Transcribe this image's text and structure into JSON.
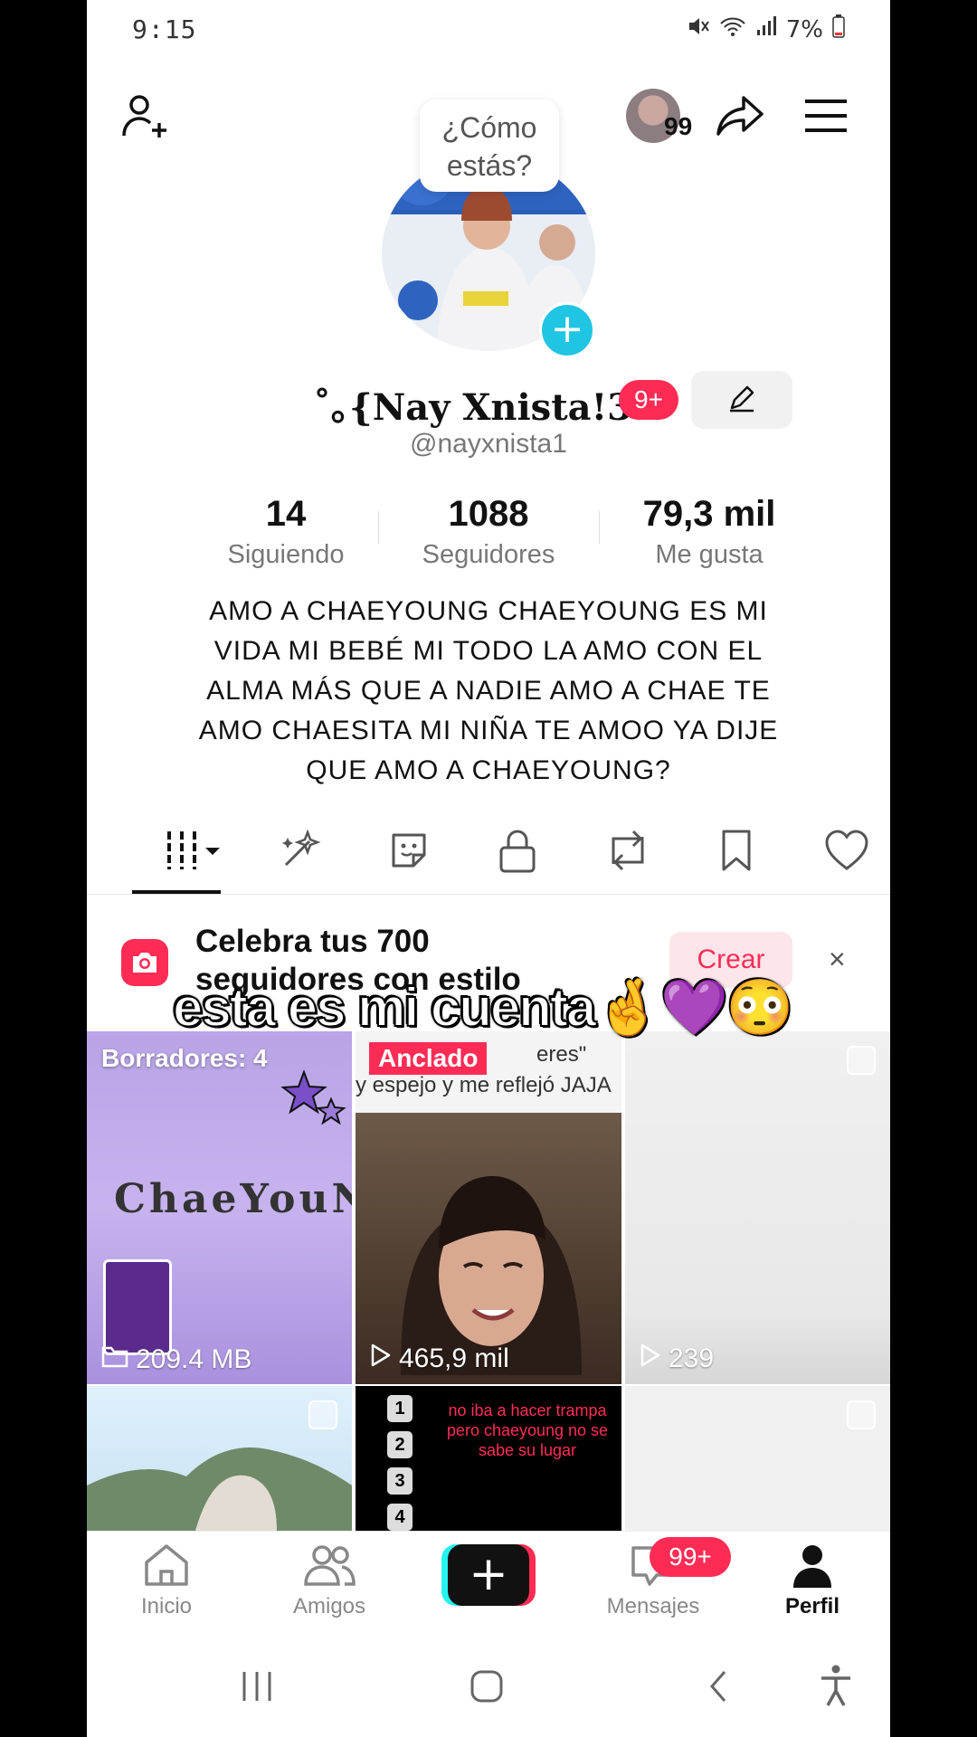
{
  "status": {
    "time": "9:15",
    "battery": "7%"
  },
  "header": {
    "story_bubble": "¿Cómo estás?",
    "friends_count": "99"
  },
  "profile": {
    "name": "˚｡{Nay Xnista!3",
    "badge": "9+",
    "handle": "@nayxnista1",
    "stats": [
      {
        "value": "14",
        "label": "Siguiendo"
      },
      {
        "value": "1088",
        "label": "Seguidores"
      },
      {
        "value": "79,3 mil",
        "label": "Me gusta"
      }
    ],
    "bio": "AMO A CHAEYOUNG CHAEYOUNG ES MI VIDA MI BEBÉ MI TODO LA AMO CON EL ALMA MÁS QUE A NADIE AMO A CHAE TE AMO CHAESITA MI NIÑA TE AMOO YA DIJE QUE AMO A CHAEYOUNG?"
  },
  "tabs": [
    "videos-icon",
    "sparkle-icon",
    "sticker-icon",
    "lock-icon",
    "repost-icon",
    "bookmark-icon",
    "heart-icon"
  ],
  "banner": {
    "line1": "Celebra tus 700",
    "line2": "seguidores con estilo",
    "button": "Crear",
    "close": "×"
  },
  "overlay_caption": "esta es mi cuenta🤞💜😳",
  "grid": {
    "drafts": "Borradores: 4",
    "drafts_size": "209.4 MB",
    "chae_text": "ChaeYouNg",
    "pinned": "Anclado",
    "pinned_top": "eres\"",
    "pinned_sub": "y espejo y me reflejó JAJA",
    "views2": "465,9 mil",
    "views3": "239",
    "c5_text": "no iba a hacer trampa pero chaeyoung no se sabe su lugar",
    "c5_nums": [
      "1",
      "2",
      "3",
      "4"
    ]
  },
  "nav": {
    "home": "Inicio",
    "friends": "Amigos",
    "plus": "+",
    "messages": "Mensajes",
    "messages_badge": "99+",
    "profile": "Perfil"
  },
  "colors": {
    "accent": "#fe2c55",
    "cyan": "#25f4ee"
  }
}
